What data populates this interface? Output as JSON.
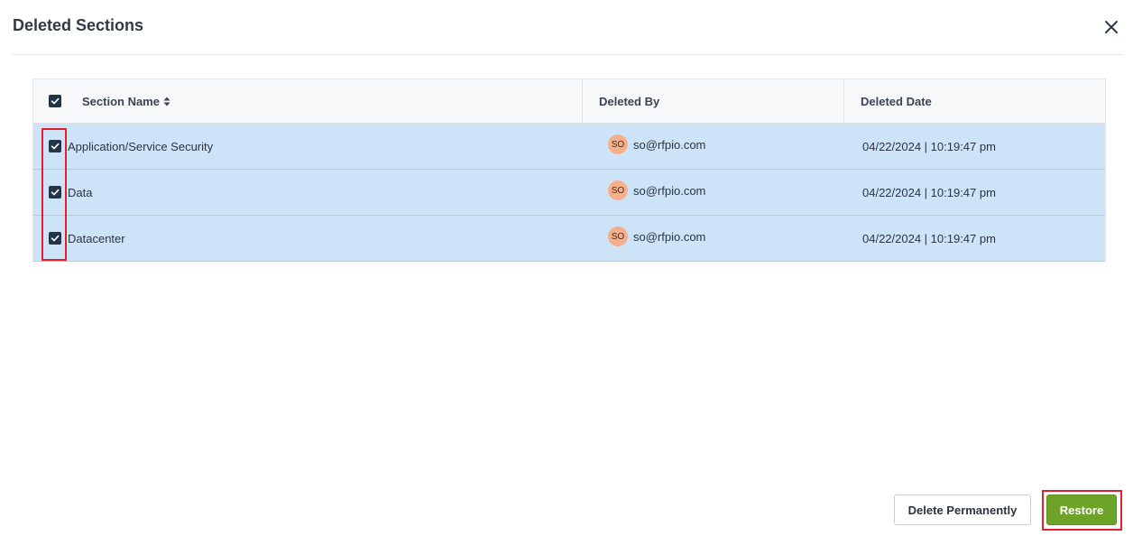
{
  "dialog": {
    "title": "Deleted Sections",
    "close_icon": "close-icon"
  },
  "table": {
    "headers": {
      "section_name": "Section Name",
      "deleted_by": "Deleted By",
      "deleted_date": "Deleted Date"
    },
    "select_all_checked": true,
    "rows": [
      {
        "section_name": "Application/Service Security",
        "avatar_initials": "SO",
        "deleted_by": "so@rfpio.com",
        "deleted_date": "04/22/2024 | 10:19:47 pm",
        "checked": true
      },
      {
        "section_name": "Data",
        "avatar_initials": "SO",
        "deleted_by": "so@rfpio.com",
        "deleted_date": "04/22/2024 | 10:19:47 pm",
        "checked": true
      },
      {
        "section_name": "Datacenter",
        "avatar_initials": "SO",
        "deleted_by": "so@rfpio.com",
        "deleted_date": "04/22/2024 | 10:19:47 pm",
        "checked": true
      }
    ]
  },
  "actions": {
    "delete_permanently_label": "Delete Permanently",
    "restore_label": "Restore"
  },
  "colors": {
    "row_selected_bg": "#cde3f7",
    "checkbox_fill": "#243447",
    "restore_button": "#6ea32a",
    "avatar_bg": "#f5b08b",
    "highlight": "#e0202a"
  }
}
